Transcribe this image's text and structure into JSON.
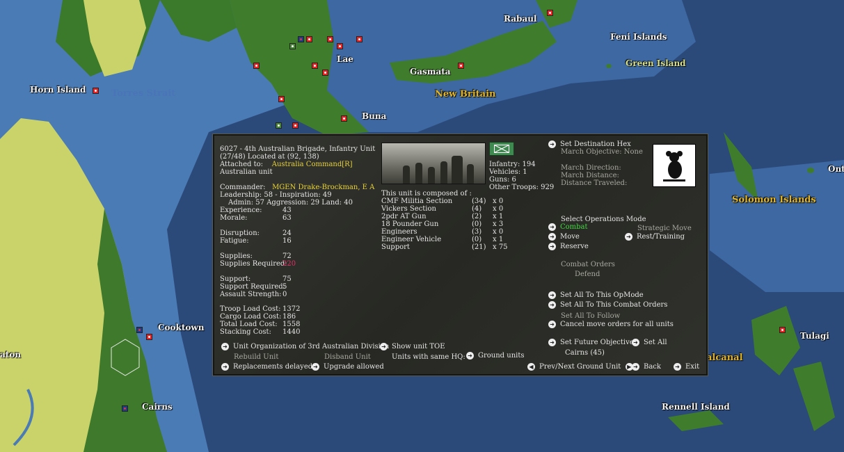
{
  "map": {
    "labels": {
      "rabaul": "Rabaul",
      "feni": "Feni Islands",
      "green": "Green Island",
      "lae": "Lae",
      "gasmata": "Gasmata",
      "new_britain": "New Britain",
      "horn": "Horn Island",
      "torres": "Torres Strait",
      "buna": "Buna",
      "solomon": "Solomon Islands",
      "ont": "Ont",
      "cooktown": "Cooktown",
      "tulagi": "Tulagi",
      "guadalcanal": "alcanal",
      "aton": "aton",
      "cairns": "Cairns",
      "rennell": "Rennell Island"
    }
  },
  "unit": {
    "title": "6027 - 4th Australian Brigade, Infantry Unit",
    "location": "(27/48) Located at (92, 138)",
    "attached_label": "Attached to:",
    "attached_value": "Australia Command[R]",
    "nationality": "Australian unit",
    "commander_label": "Commander:",
    "commander_value": "MGEN Drake-Brockman, E A",
    "leadership": "Leadership: 58 - Inspiration: 49",
    "admin": "Admin: 57  Aggression: 29  Land: 40",
    "stats1": [
      {
        "label": "Experience:",
        "value": "43"
      },
      {
        "label": "Morale:",
        "value": "63"
      }
    ],
    "stats2": [
      {
        "label": "Disruption:",
        "value": "24"
      },
      {
        "label": "Fatigue:",
        "value": "16"
      }
    ],
    "supplies_label": "Supplies:",
    "supplies_value": "72",
    "supplies_req_label": "Supplies Required:",
    "supplies_req_value": "220",
    "stats3": [
      {
        "label": "Support:",
        "value": "75"
      },
      {
        "label": "Support Required:",
        "value": "5"
      },
      {
        "label": "Assault Strength:",
        "value": "0"
      }
    ],
    "stats4": [
      {
        "label": "Troop Load Cost:",
        "value": "1372"
      },
      {
        "label": "Cargo Load Cost:",
        "value": "186"
      },
      {
        "label": "Total Load Cost:",
        "value": "1558"
      },
      {
        "label": "Stacking Cost:",
        "value": "1440"
      }
    ],
    "troops": {
      "infantry": "Infantry: 194",
      "vehicles": "Vehicles: 1",
      "guns": "Guns: 6",
      "other": "Other Troops: 929"
    },
    "composed_title": "This unit is composed of :",
    "composition": [
      {
        "name": "CMF Militia Section",
        "count": "(34)",
        "x": "x 0"
      },
      {
        "name": "Vickers Section",
        "count": "(4)",
        "x": "x 0"
      },
      {
        "name": "2pdr AT Gun",
        "count": "(2)",
        "x": "x 1"
      },
      {
        "name": "18 Pounder Gun",
        "count": "(0)",
        "x": "x 3"
      },
      {
        "name": "Engineers",
        "count": "(3)",
        "x": "x 0"
      },
      {
        "name": "Engineer Vehicle",
        "count": "(0)",
        "x": "x 1"
      },
      {
        "name": "Support",
        "count": "(21)",
        "x": "x 75"
      }
    ],
    "march": {
      "set_dest": "Set Destination Hex",
      "objective": "March Objective: None",
      "direction": "March Direction:",
      "distance": "March Distance:",
      "traveled": "Distance Traveled:"
    },
    "ops": {
      "title": "Select Operations Mode",
      "combat": "Combat",
      "strategic": "Strategic Move",
      "move": "Move",
      "rest": "Rest/Training",
      "reserve": "Reserve"
    },
    "combat_orders": {
      "title": "Combat Orders",
      "value": "Defend"
    },
    "set_all": {
      "opmode": "Set All To This OpMode",
      "orders": "Set All To This Combat Orders",
      "follow": "Set All To Follow",
      "cancel": "Cancel move orders for all units"
    },
    "future": {
      "set": "Set Future Objective",
      "set_all": "Set All",
      "value": "Cairns (45)"
    },
    "bottom": {
      "org": "Unit Organization of 3rd Australian Division",
      "toe": "Show unit TOE",
      "rebuild": "Rebuild Unit",
      "disband": "Disband Unit",
      "same_hq": "Units with same HQ:",
      "ground": "Ground units",
      "replacements": "Replacements delayed",
      "upgrade": "Upgrade allowed",
      "prevnext": "Prev/Next Ground Unit",
      "back": "Back",
      "exit": "Exit"
    }
  }
}
